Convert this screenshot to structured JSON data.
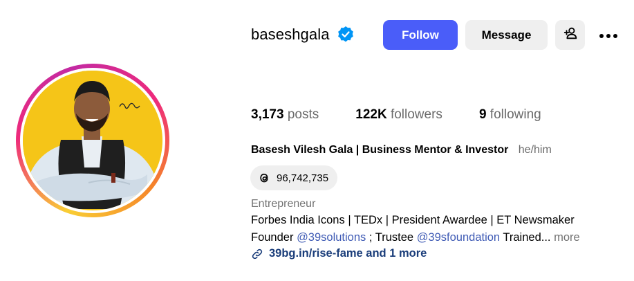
{
  "profile": {
    "username": "baseshgala",
    "full_name": "Basesh Vilesh Gala | Business Mentor & Investor",
    "pronouns": "he/him",
    "threads_count": "96,742,735",
    "category": "Entrepreneur"
  },
  "actions": {
    "follow_label": "Follow",
    "message_label": "Message"
  },
  "stats": {
    "posts_value": "3,173",
    "posts_label": "posts",
    "followers_value": "122K",
    "followers_label": "followers",
    "following_value": "9",
    "following_label": "following"
  },
  "bio": {
    "line1": "Forbes India Icons | TEDx | President Awardee | ET Newsmaker",
    "line2_prefix": "Founder",
    "mention1": "@39solutions",
    "line2_middle": "; Trustee",
    "mention2": "@39sfoundation",
    "line2_suffix": "Trained...",
    "more_label": "more"
  },
  "link": {
    "text": "39bg.in/rise-fame and 1 more"
  },
  "colors": {
    "accent": "#4a5df9",
    "verified": "#0095f6",
    "avatar_bg": "#f5c518"
  }
}
